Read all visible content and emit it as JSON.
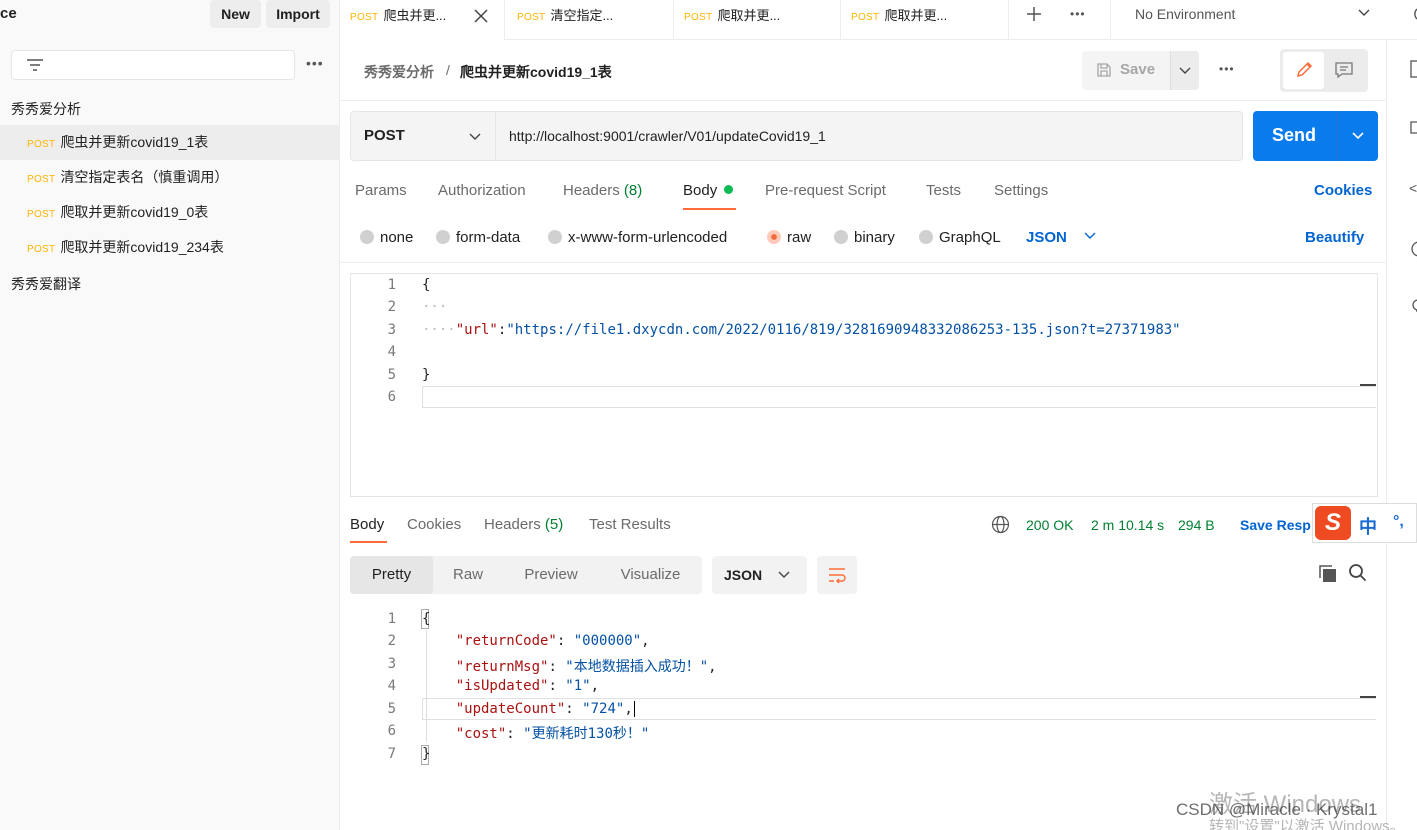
{
  "sidebar": {
    "title": "ce",
    "new_label": "New",
    "import_label": "Import",
    "collections": [
      {
        "name": "秀秀爱分析",
        "requests": [
          {
            "method": "POST",
            "name": "爬虫并更新covid19_1表"
          },
          {
            "method": "POST",
            "name": "清空指定表名（慎重调用）"
          },
          {
            "method": "POST",
            "name": "爬取并更新covid19_0表"
          },
          {
            "method": "POST",
            "name": "爬取并更新covid19_234表"
          }
        ]
      },
      {
        "name": "秀秀爱翻译",
        "requests": []
      }
    ]
  },
  "tabs": [
    {
      "method": "POST",
      "name": "爬虫并更..."
    },
    {
      "method": "POST",
      "name": "清空指定..."
    },
    {
      "method": "POST",
      "name": "爬取并更..."
    },
    {
      "method": "POST",
      "name": "爬取并更..."
    }
  ],
  "environment": "No Environment",
  "breadcrumb": {
    "collection": "秀秀爱分析",
    "separator": "/",
    "request": "爬虫并更新covid19_1表"
  },
  "save_label": "Save",
  "request": {
    "method": "POST",
    "url": "http://localhost:9001/crawler/V01/updateCovid19_1",
    "send_label": "Send",
    "tabs": [
      "Params",
      "Authorization",
      "Headers",
      "Body",
      "Pre-request Script",
      "Tests",
      "Settings"
    ],
    "headers_count": "(8)",
    "cookies_label": "Cookies",
    "body_types": [
      "none",
      "form-data",
      "x-www-form-urlencoded",
      "raw",
      "binary",
      "GraphQL"
    ],
    "body_format": "JSON",
    "beautify_label": "Beautify",
    "body_lines": [
      "1",
      "2",
      "3",
      "4",
      "5",
      "6"
    ],
    "body_code": {
      "l1": "{",
      "l3_key": "\"url\"",
      "l3_colon": ":",
      "l3_val": "\"https://file1.dxycdn.com/2022/0116/819/3281690948332086253-135.json?t=27371983\"",
      "l5": "}"
    }
  },
  "response": {
    "tabs": [
      "Body",
      "Cookies",
      "Headers",
      "Test Results"
    ],
    "headers_count": "(5)",
    "status": "200 OK",
    "time": "2 m 10.14 s",
    "size": "294 B",
    "save_label": "Save Resp",
    "views": [
      "Pretty",
      "Raw",
      "Preview",
      "Visualize"
    ],
    "format": "JSON",
    "lines": [
      "1",
      "2",
      "3",
      "4",
      "5",
      "6",
      "7"
    ],
    "code": [
      {
        "k": "\"returnCode\"",
        "v": "\"000000\""
      },
      {
        "k": "\"returnMsg\"",
        "v": "\"本地数据插入成功！\""
      },
      {
        "k": "\"isUpdated\"",
        "v": "\"1\""
      },
      {
        "k": "\"updateCount\"",
        "v": "\"724\""
      },
      {
        "k": "\"cost\"",
        "v": "\"更新耗时130秒！\""
      }
    ],
    "open_brace": "{",
    "close_brace": "}"
  },
  "ime": {
    "logo": "S",
    "lang": "中",
    "punct": "°,"
  },
  "watermark": {
    "line1": "激活 Windows",
    "line2": "转到\"设置\"以激活 Windows。",
    "csdn": "CSDN @Miracle · Krystal1"
  },
  "colors": {
    "accent": "#ff6c37",
    "send": "#097bed",
    "post": "#ffb400",
    "ok": "#007f31"
  }
}
